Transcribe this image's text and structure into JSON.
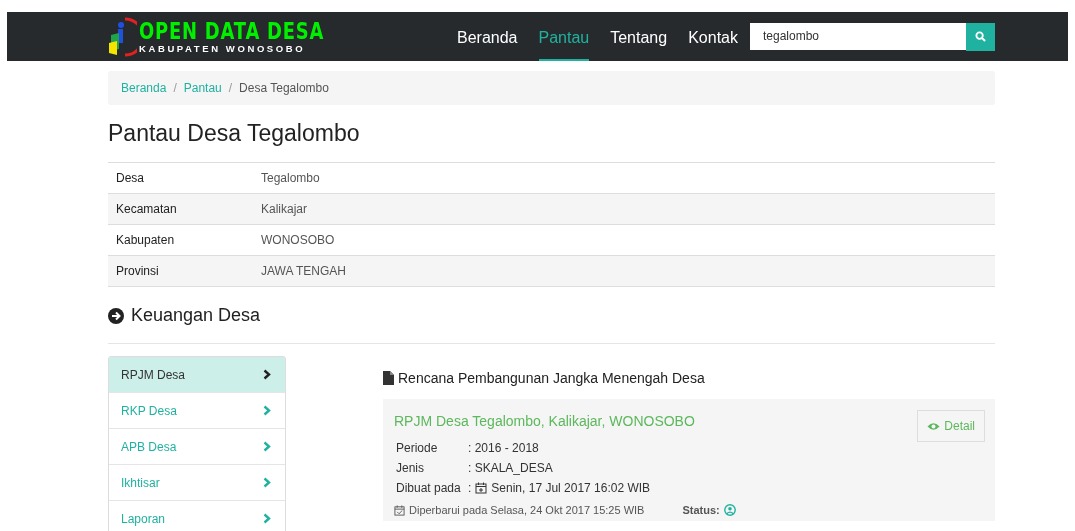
{
  "navbar": {
    "logo_title": "OPEN DATA DESA",
    "logo_subtitle": "KABUPATEN WONOSOBO",
    "menu": [
      {
        "label": "Beranda",
        "selected": false
      },
      {
        "label": "Pantau",
        "selected": true
      },
      {
        "label": "Tentang",
        "selected": false
      },
      {
        "label": "Kontak",
        "selected": false
      }
    ],
    "search": {
      "value": "tegalombo"
    }
  },
  "breadcrumb": {
    "separator": "/",
    "items": [
      {
        "label": "Beranda",
        "kind": "link"
      },
      {
        "label": "Pantau",
        "kind": "link"
      },
      {
        "label": "Desa Tegalombo",
        "kind": "current"
      }
    ]
  },
  "page_title": "Pantau Desa Tegalombo",
  "info_table": [
    {
      "label": "Desa",
      "value": "Tegalombo"
    },
    {
      "label": "Kecamatan",
      "value": "Kalikajar"
    },
    {
      "label": "Kabupaten",
      "value": "WONOSOBO"
    },
    {
      "label": "Provinsi",
      "value": "JAWA TENGAH"
    }
  ],
  "section_title": "Keuangan Desa",
  "sidebar": {
    "items": [
      {
        "label": "RPJM Desa",
        "selected": true
      },
      {
        "label": "RKP Desa",
        "selected": false
      },
      {
        "label": "APB Desa",
        "selected": false
      },
      {
        "label": "Ikhtisar",
        "selected": false
      },
      {
        "label": "Laporan",
        "selected": false
      }
    ]
  },
  "panel": {
    "title": "Rencana Pembangunan Jangka Menengah Desa",
    "card": {
      "title": "RPJM Desa Tegalombo, Kalikajar, WONOSOBO",
      "button": "Detail",
      "fields": [
        {
          "label": "Periode",
          "value": ": 2016 - 2018",
          "kind": "text"
        },
        {
          "label": "Jenis",
          "value": ": SKALA_DESA",
          "kind": "text"
        },
        {
          "label": "Dibuat pada",
          "colon": ":",
          "value": "Senin, 17 Jul 2017 16:02 WIB",
          "kind": "date"
        }
      ],
      "updated": "Diperbarui pada Selasa, 24 Okt 2017 15:25 WIB",
      "status_label": "Status:"
    }
  }
}
